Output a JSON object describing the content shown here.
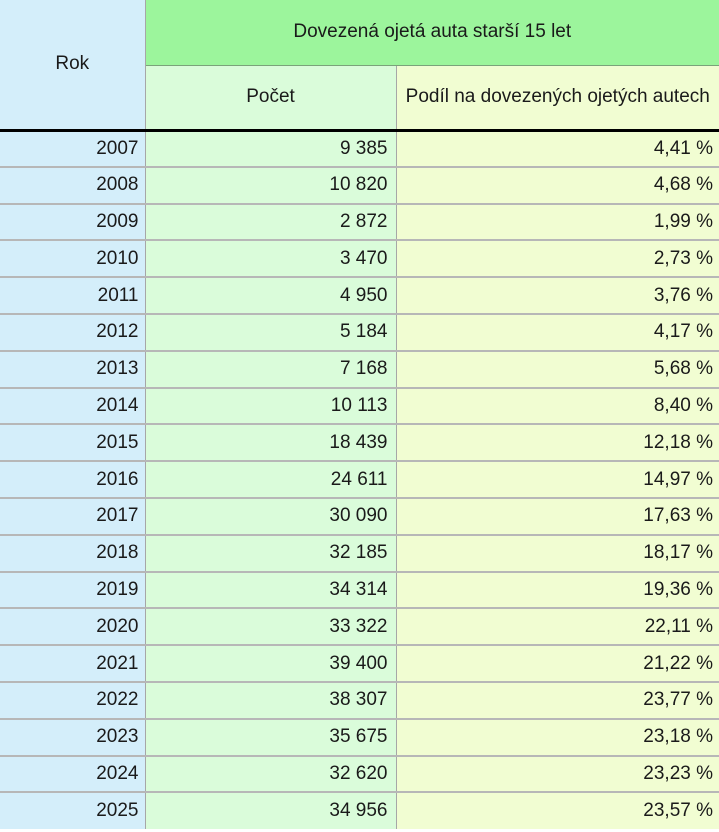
{
  "header": {
    "year": "Rok",
    "group": "Dovezená ojetá auta starší 15 let",
    "count": "Počet",
    "share": "Podíl na dovezených ojetých autech"
  },
  "rows": [
    {
      "year": "2007",
      "count": "9 385",
      "share": "4,41 %"
    },
    {
      "year": "2008",
      "count": "10 820",
      "share": "4,68 %"
    },
    {
      "year": "2009",
      "count": "2 872",
      "share": "1,99 %"
    },
    {
      "year": "2010",
      "count": "3 470",
      "share": "2,73 %"
    },
    {
      "year": "2011",
      "count": "4 950",
      "share": "3,76 %"
    },
    {
      "year": "2012",
      "count": "5 184",
      "share": "4,17 %"
    },
    {
      "year": "2013",
      "count": "7 168",
      "share": "5,68 %"
    },
    {
      "year": "2014",
      "count": "10 113",
      "share": "8,40 %"
    },
    {
      "year": "2015",
      "count": "18 439",
      "share": "12,18 %"
    },
    {
      "year": "2016",
      "count": "24 611",
      "share": "14,97 %"
    },
    {
      "year": "2017",
      "count": "30 090",
      "share": "17,63 %"
    },
    {
      "year": "2018",
      "count": "32 185",
      "share": "18,17 %"
    },
    {
      "year": "2019",
      "count": "34 314",
      "share": "19,36 %"
    },
    {
      "year": "2020",
      "count": "33 322",
      "share": "22,11 %"
    },
    {
      "year": "2021",
      "count": "39 400",
      "share": "21,22 %"
    },
    {
      "year": "2022",
      "count": "38 307",
      "share": "23,77 %"
    },
    {
      "year": "2023",
      "count": "35 675",
      "share": "23,18 %"
    },
    {
      "year": "2024",
      "count": "32 620",
      "share": "23,23 %"
    },
    {
      "year": "2025",
      "count": "34 956",
      "share": "23,57 %"
    }
  ]
}
